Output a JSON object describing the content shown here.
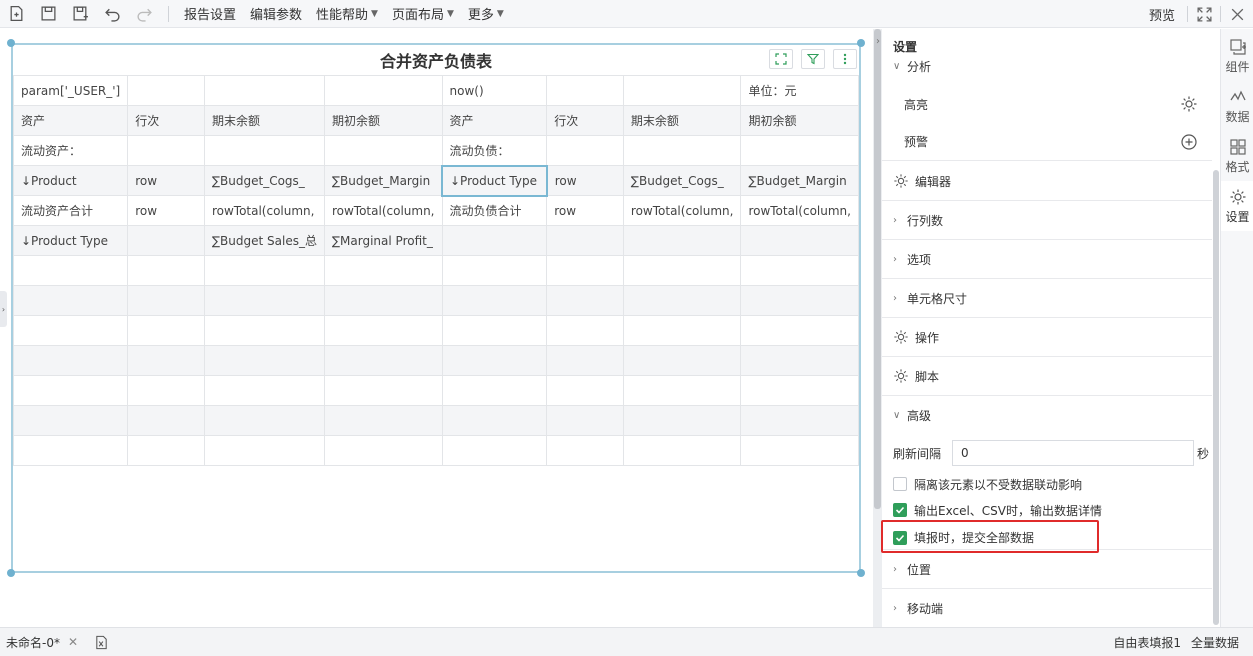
{
  "toolbar": {
    "menus": [
      {
        "label": "报告设置",
        "caret": false
      },
      {
        "label": "编辑参数",
        "caret": false
      },
      {
        "label": "性能帮助",
        "caret": true
      },
      {
        "label": "页面布局",
        "caret": true
      },
      {
        "label": "更多",
        "caret": true
      }
    ],
    "preview_label": "预览"
  },
  "report": {
    "title": "合并资产负债表",
    "rows": [
      [
        "param['_USER_']",
        "",
        "",
        "",
        "now()",
        "",
        "",
        "单位：元"
      ],
      [
        "资产",
        "行次",
        "期末余额",
        "期初余额",
        "资产",
        "行次",
        "期末余额",
        "期初余额"
      ],
      [
        "流动资产：",
        "",
        "",
        "",
        "流动负债：",
        "",
        "",
        ""
      ],
      [
        "↓Product",
        "row",
        "∑Budget_Cogs_",
        "∑Budget_Margin",
        "↓Product Type",
        "row",
        "∑Budget_Cogs_",
        "∑Budget_Margin"
      ],
      [
        "流动资产合计",
        "row",
        "rowTotal(column,",
        "rowTotal(column,",
        "流动负债合计",
        "row",
        "rowTotal(column,",
        "rowTotal(column,"
      ],
      [
        "↓Product Type",
        "",
        "∑Budget Sales_总",
        "∑Marginal Profit_",
        "",
        "",
        "",
        ""
      ],
      [
        "",
        "",
        "",
        "",
        "",
        "",
        "",
        ""
      ],
      [
        "",
        "",
        "",
        "",
        "",
        "",
        "",
        ""
      ],
      [
        "",
        "",
        "",
        "",
        "",
        "",
        "",
        ""
      ],
      [
        "",
        "",
        "",
        "",
        "",
        "",
        "",
        ""
      ],
      [
        "",
        "",
        "",
        "",
        "",
        "",
        "",
        ""
      ],
      [
        "",
        "",
        "",
        "",
        "",
        "",
        "",
        ""
      ],
      [
        "",
        "",
        "",
        "",
        "",
        "",
        "",
        ""
      ]
    ],
    "selected_cell": [
      3,
      4
    ]
  },
  "panel": {
    "title": "设置",
    "analysis_label": "分析",
    "highlight_label": "高亮",
    "warning_label": "预警",
    "editor_label": "编辑器",
    "rowcol_label": "行列数",
    "options_label": "选项",
    "cellsize_label": "单元格尺寸",
    "operation_label": "操作",
    "script_label": "脚本",
    "advanced_label": "高级",
    "refresh_label": "刷新间隔",
    "refresh_value": "0",
    "refresh_unit": "秒",
    "checkbox_isolate": "隔离该元素以不受数据联动影响",
    "checkbox_export": "输出Excel、CSV时，输出数据详情",
    "checkbox_submit": "填报时，提交全部数据",
    "position_label": "位置",
    "mobile_label": "移动端"
  },
  "rtabs": {
    "component": "组件",
    "data": "数据",
    "format": "格式",
    "settings": "设置"
  },
  "status": {
    "tab_label": "未命名-0*",
    "sheet_label": "自由表填报1",
    "all_data_label": "全量数据"
  }
}
